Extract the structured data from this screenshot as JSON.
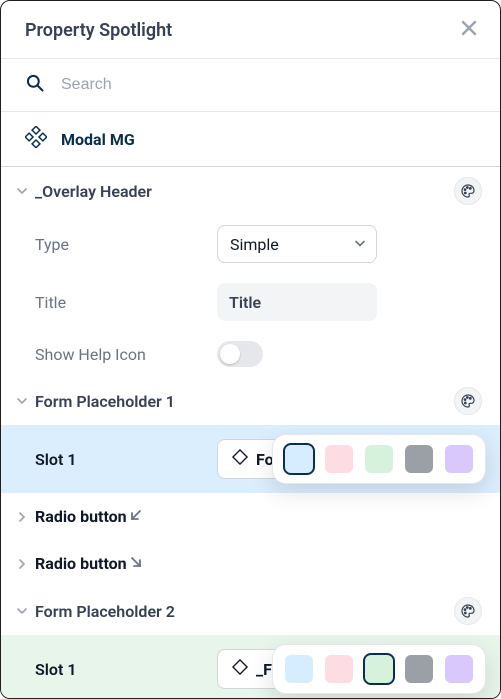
{
  "header": {
    "title": "Property Spotlight"
  },
  "search": {
    "placeholder": "Search"
  },
  "component": {
    "name": "Modal MG"
  },
  "sections": {
    "overlay_header": {
      "title": "_Overlay Header",
      "props": {
        "type_label": "Type",
        "type_value": "Simple",
        "title_label": "Title",
        "title_value": "Title",
        "show_help_label": "Show Help Icon"
      }
    },
    "form1": {
      "title": "Form Placeholder 1",
      "slot_label": "Slot 1",
      "slot_value": "Forms",
      "highlight_color": "blue",
      "palette_selected": "blue"
    },
    "radio1": {
      "title": "Radio button",
      "direction": "sw"
    },
    "radio2": {
      "title": "Radio button",
      "direction": "se"
    },
    "form2": {
      "title": "Form Placeholder 2",
      "slot_label": "Slot 1",
      "slot_value": "_Form",
      "highlight_color": "green",
      "palette_selected": "green"
    }
  },
  "palette_colors": [
    "blue",
    "pink",
    "green",
    "gray",
    "purple"
  ]
}
